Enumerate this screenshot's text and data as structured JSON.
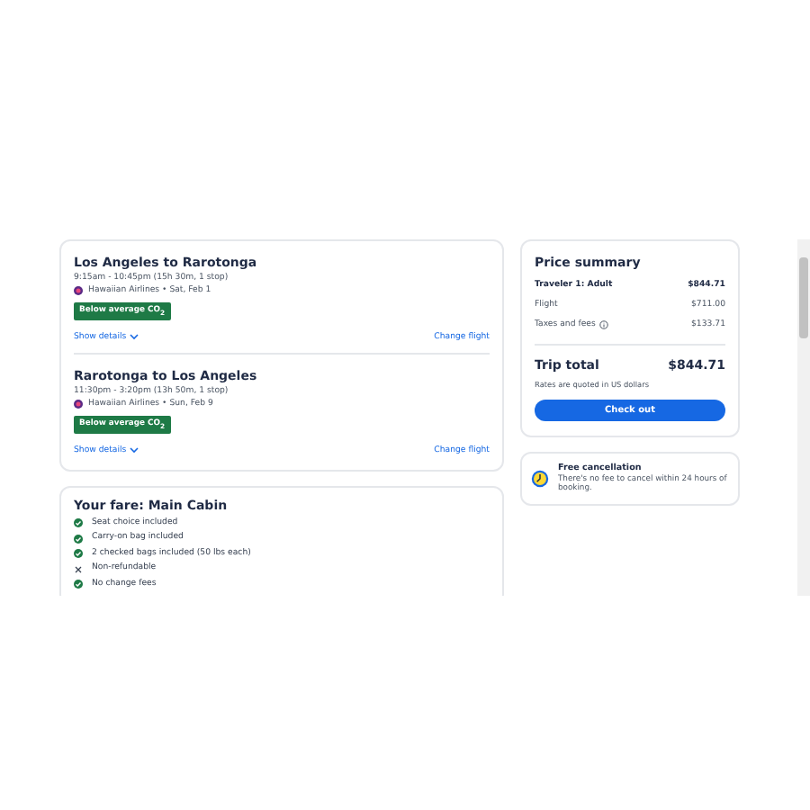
{
  "flights": [
    {
      "route": "Los Angeles to Rarotonga",
      "times": "9:15am - 10:45pm (15h 30m, 1 stop)",
      "airline": "Hawaiian Airlines • Sat, Feb 1",
      "badge": "Below average CO$_{2}$",
      "details": "Show details",
      "change": "Change flight"
    },
    {
      "route": "Rarotonga to Los Angeles",
      "times": "11:30pm - 3:20pm (13h 50m, 1 stop)",
      "airline": "Hawaiian Airlines • Sun, Feb 9",
      "badge": "Below average CO$_{2}$",
      "details": "Show details",
      "change": "Change flight"
    }
  ],
  "fare": {
    "title": "Your fare: Main Cabin",
    "items": [
      {
        "kind": "included",
        "text": "Seat choice included"
      },
      {
        "kind": "included",
        "text": "Carry-on bag included"
      },
      {
        "kind": "included",
        "text": "2 checked bags included (50 lbs each)"
      },
      {
        "kind": "excluded",
        "text": "Non-refundable"
      },
      {
        "kind": "included",
        "text": "No change fees"
      }
    ]
  },
  "price_summary": {
    "title": "Price summary",
    "rows": [
      {
        "kind": "bold",
        "label": "Traveler 1: Adult",
        "amount": "$844.71"
      },
      {
        "kind": "plain",
        "label": "Flight",
        "amount": "$711.00"
      },
      {
        "kind": "info",
        "label": "Taxes and fees",
        "amount": "$133.71"
      }
    ],
    "total_label": "Trip total",
    "total": "$844.71",
    "note": "Rates are quoted in US dollars",
    "button": "Check out"
  },
  "cancellation": {
    "title": "Free cancellation",
    "text": "There's no fee to cancel within 24 hours of booking."
  }
}
